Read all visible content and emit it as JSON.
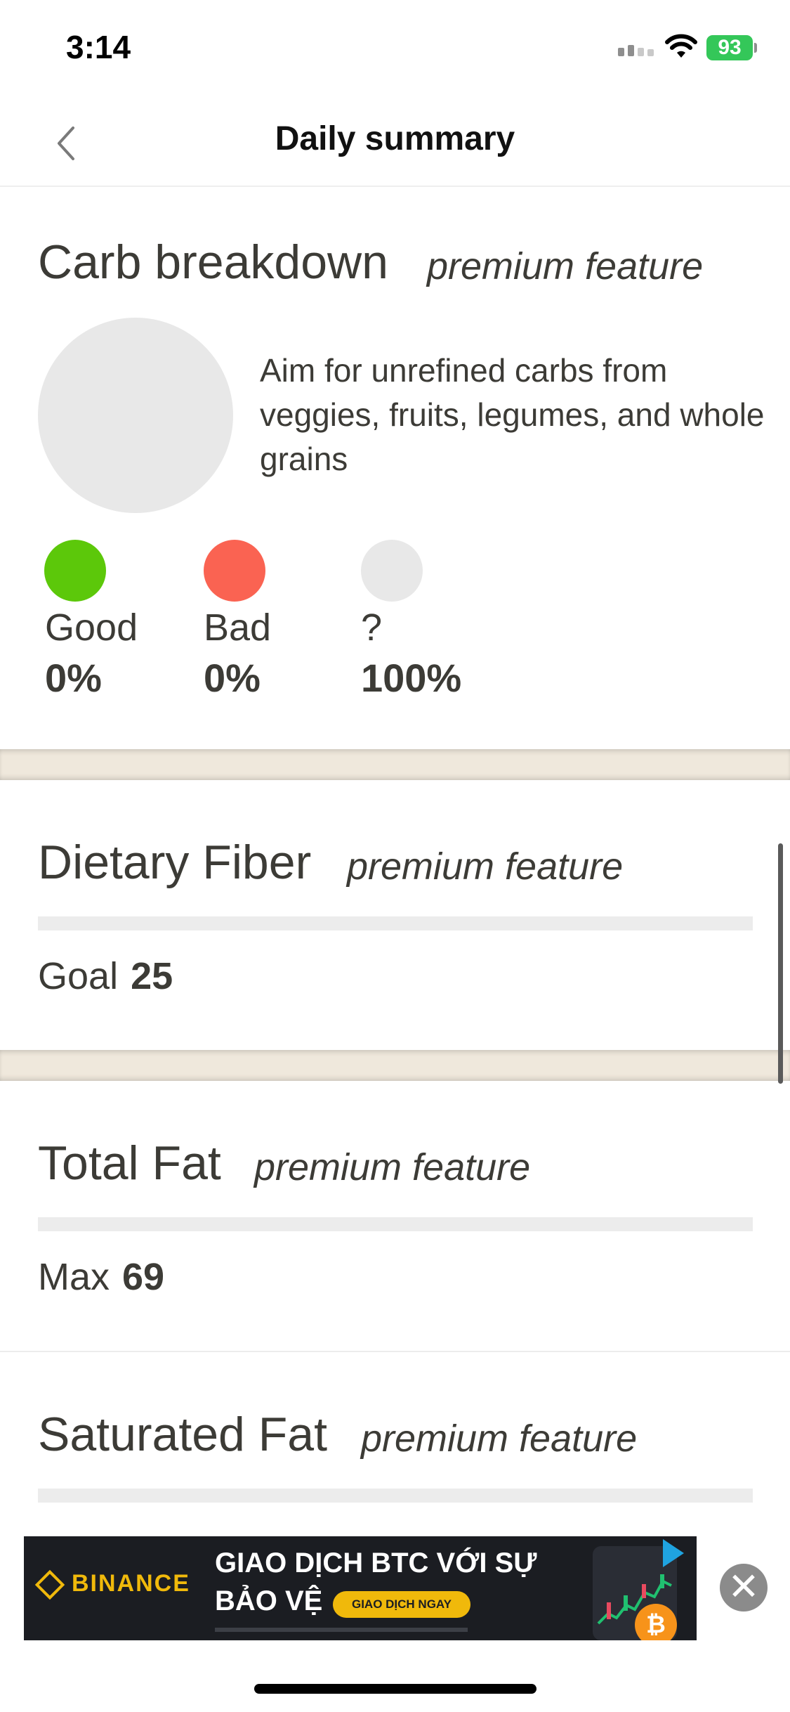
{
  "status_bar": {
    "time": "3:14",
    "battery": "93"
  },
  "nav": {
    "title": "Daily summary"
  },
  "carb_breakdown": {
    "title": "Carb breakdown",
    "premium": "premium feature",
    "aim_text": "Aim for unrefined carbs from veggies, fruits, legumes, and whole grains",
    "legend": [
      {
        "label": "Good",
        "percent": "0%",
        "color": "#5cc80a"
      },
      {
        "label": "Bad",
        "percent": "0%",
        "color": "#fa6352"
      },
      {
        "label": "?",
        "percent": "100%",
        "color": "#e8e8e8"
      }
    ]
  },
  "dietary_fiber": {
    "title": "Dietary Fiber",
    "premium": "premium feature",
    "goal_label": "Goal",
    "goal_value": "25"
  },
  "total_fat": {
    "title": "Total Fat",
    "premium": "premium feature",
    "max_label": "Max",
    "max_value": "69"
  },
  "saturated_fat": {
    "title": "Saturated Fat",
    "premium": "premium feature"
  },
  "ad": {
    "brand": "BINANCE",
    "line1": "GIAO DỊCH BTC VỚI SỰ",
    "line2": "BẢO VỆ",
    "cta": "GIAO DỊCH NGAY",
    "coin_symbol": "₿",
    "close_symbol": "✕"
  },
  "colors": {
    "good": "#5cc80a",
    "bad": "#fa6352",
    "unknown": "#e8e8e8",
    "battery": "#34c759",
    "ad_accent": "#f0b90b"
  }
}
